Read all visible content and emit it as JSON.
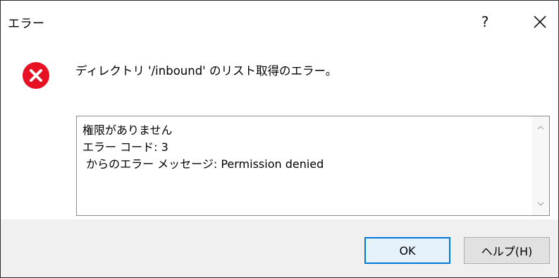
{
  "window": {
    "title": "エラー",
    "help_glyph": "?",
    "close_icon": "close-icon"
  },
  "message": {
    "icon": "error-icon",
    "text": "ディレクトリ '/inbound' のリスト取得のエラー。"
  },
  "details": {
    "lines": [
      "権限がありません",
      "エラー コード: 3",
      " からのエラー メッセージ: Permission denied"
    ]
  },
  "buttons": {
    "ok_label": "OK",
    "help_label": "ヘルプ(H)"
  },
  "colors": {
    "error_red": "#e81123",
    "accent_blue": "#0078d7",
    "button_bar_bg": "#f0f0f0"
  }
}
